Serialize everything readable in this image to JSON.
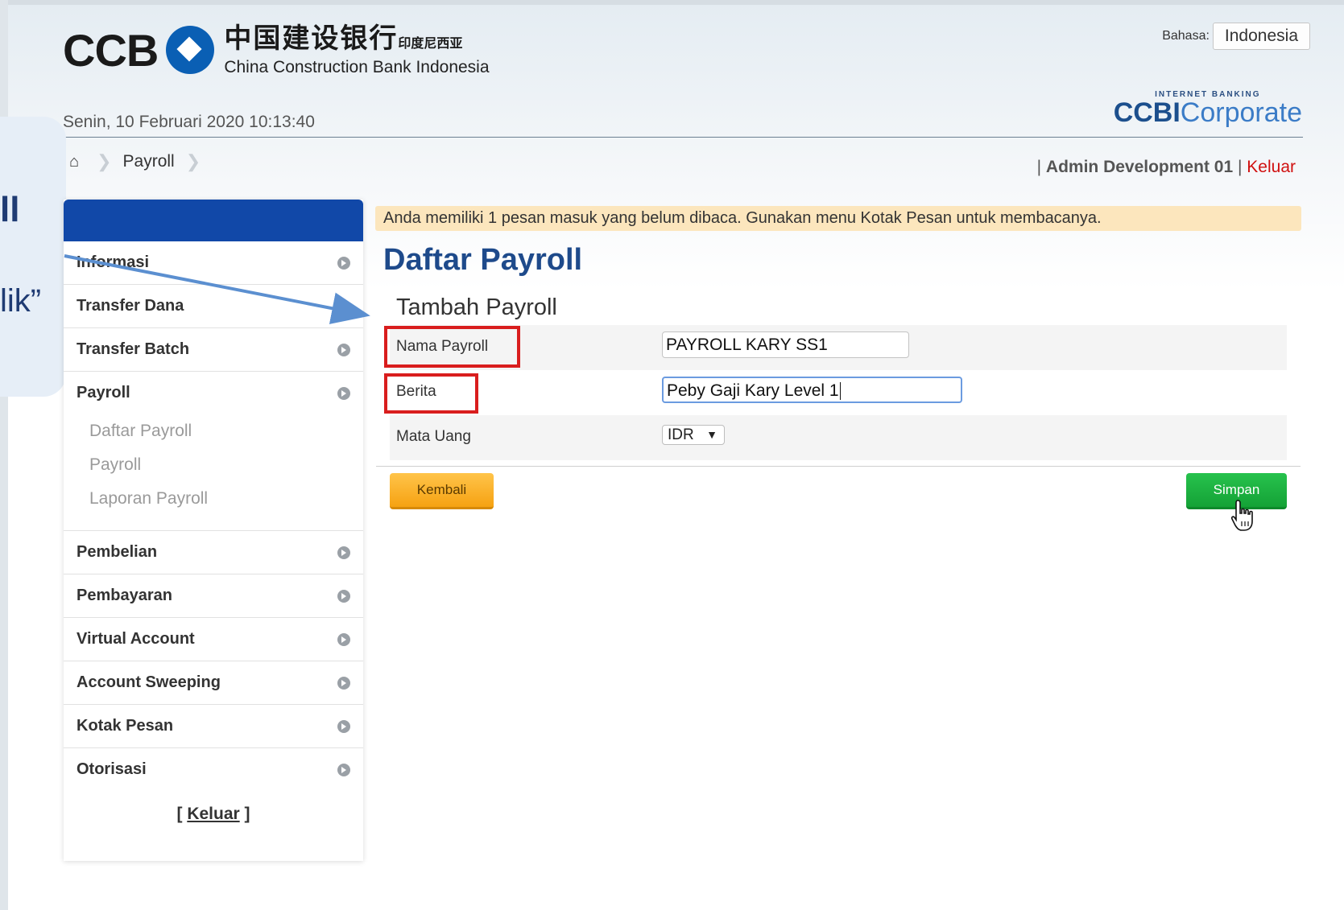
{
  "header": {
    "logo_ccb": "CCB",
    "logo_cn": "中国建设银行",
    "logo_cn_small": "印度尼西亚",
    "logo_en": "China Construction Bank Indonesia",
    "language_label": "Bahasa:",
    "language_value": "Indonesia",
    "product_top": "INTERNET BANKING",
    "product_main": "CCBI",
    "product_sub": "Corporate",
    "datetime": "Senin, 10 Februari 2020 10:13:40"
  },
  "breadcrumb": {
    "current": "Payroll"
  },
  "userbar": {
    "sep": "|",
    "user": "Admin Development 01",
    "logout": "Keluar"
  },
  "callout": {
    "text1": "ll",
    "text2": "lik”"
  },
  "sidebar": {
    "items": [
      {
        "label": "Informasi"
      },
      {
        "label": "Transfer Dana"
      },
      {
        "label": "Transfer Batch"
      },
      {
        "label": "Payroll"
      },
      {
        "label": "Pembelian"
      },
      {
        "label": "Pembayaran"
      },
      {
        "label": "Virtual Account"
      },
      {
        "label": "Account Sweeping"
      },
      {
        "label": "Kotak Pesan"
      },
      {
        "label": "Otorisasi"
      }
    ],
    "payroll_sub": [
      "Daftar Payroll",
      "Payroll",
      "Laporan Payroll"
    ],
    "logout": "Keluar"
  },
  "main": {
    "notice": "Anda memiliki 1 pesan masuk yang belum dibaca. Gunakan menu Kotak Pesan untuk membacanya.",
    "title": "Daftar Payroll",
    "subtitle": "Tambah Payroll",
    "fields": {
      "nama_label": "Nama Payroll",
      "nama_value": "PAYROLL KARY SS1",
      "berita_label": "Berita",
      "berita_value": "Peby Gaji Kary Level 1",
      "mata_uang_label": "Mata Uang",
      "mata_uang_value": "IDR"
    },
    "back_button": "Kembali",
    "save_button": "Simpan"
  },
  "colors": {
    "brand_blue": "#1148a8",
    "title_blue": "#1e4a8b",
    "highlight_red": "#d91d1d",
    "save_green": "#14a236",
    "back_orange": "#f6a212",
    "notice_bg": "#fce6bd"
  },
  "icons": [
    "home-icon",
    "chevron-right-icon",
    "dropdown-arrow-icon",
    "hand-cursor-icon",
    "annotation-arrow-icon"
  ]
}
